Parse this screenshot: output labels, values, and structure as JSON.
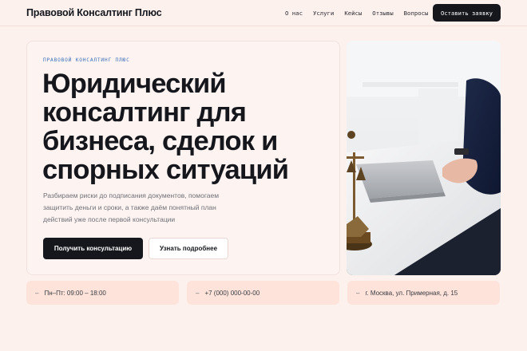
{
  "header": {
    "brand": "Правовой Консалтинг Плюс",
    "nav": [
      "О нас",
      "Услуги",
      "Кейсы",
      "Отзывы",
      "Вопросы"
    ],
    "cta": "Оставить заявку"
  },
  "hero": {
    "eyebrow": "ПРАВОВОЙ КОНСАЛТИНГ ПЛЮС",
    "title_lines": [
      "Юридический",
      "консалтинг для",
      "бизнеса, сделок и",
      "спорных ситуаций"
    ],
    "description_lines": [
      "Разбираем риски до подписания документов, помогаем",
      "защитить деньги и сроки, а также даём понятный план",
      "действий уже после первой консультации"
    ],
    "primary_button": "Получить консультацию",
    "secondary_button": "Узнать подробнее",
    "photo_icon": "office-desk-photo"
  },
  "info": [
    {
      "dash": "–",
      "text": "Пн–Пт: 09:00 – 18:00"
    },
    {
      "dash": "–",
      "text": "+7 (000) 000-00-00"
    },
    {
      "dash": "–",
      "text": "г. Москва, ул. Примерная, д. 15"
    }
  ]
}
